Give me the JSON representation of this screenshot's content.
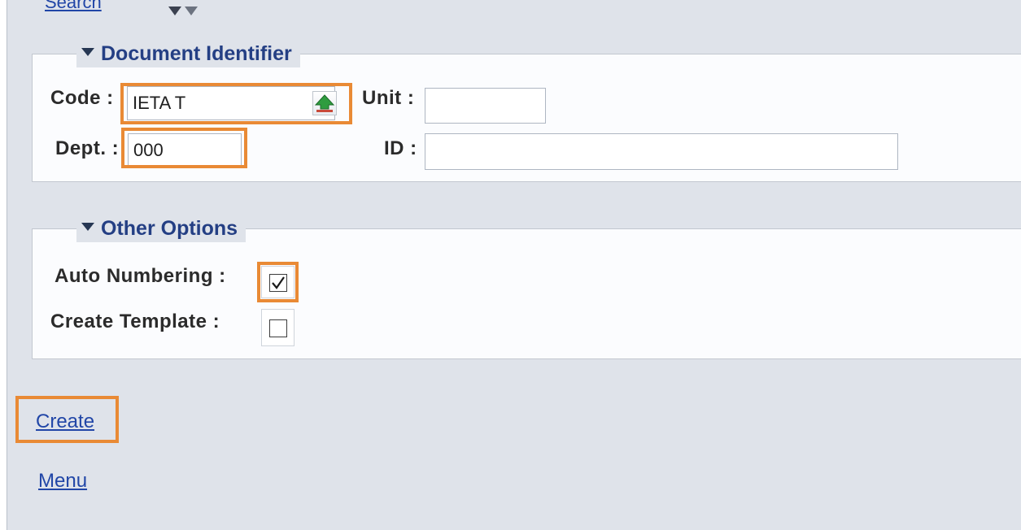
{
  "header": {
    "search_link": "Search",
    "toggle_icon": "double-down-arrow-icon"
  },
  "document_identifier": {
    "legend": "Document Identifier",
    "code_label": "Code :",
    "code_value": "IETA T",
    "lookup_icon": "lookup-up-arrow-icon",
    "unit_label": "Unit :",
    "unit_value": "",
    "dept_label": "Dept. :",
    "dept_value": "000",
    "id_label": "ID :",
    "id_value": ""
  },
  "other_options": {
    "legend": "Other Options",
    "auto_numbering_label": "Auto Numbering :",
    "auto_numbering_checked": true,
    "create_template_label": "Create Template :",
    "create_template_checked": false
  },
  "actions": {
    "create_link": "Create",
    "menu_link": "Menu"
  },
  "colors": {
    "highlight": "#e98a35",
    "link": "#2146a7",
    "legend": "#243f84",
    "background": "#dfe3ea"
  }
}
